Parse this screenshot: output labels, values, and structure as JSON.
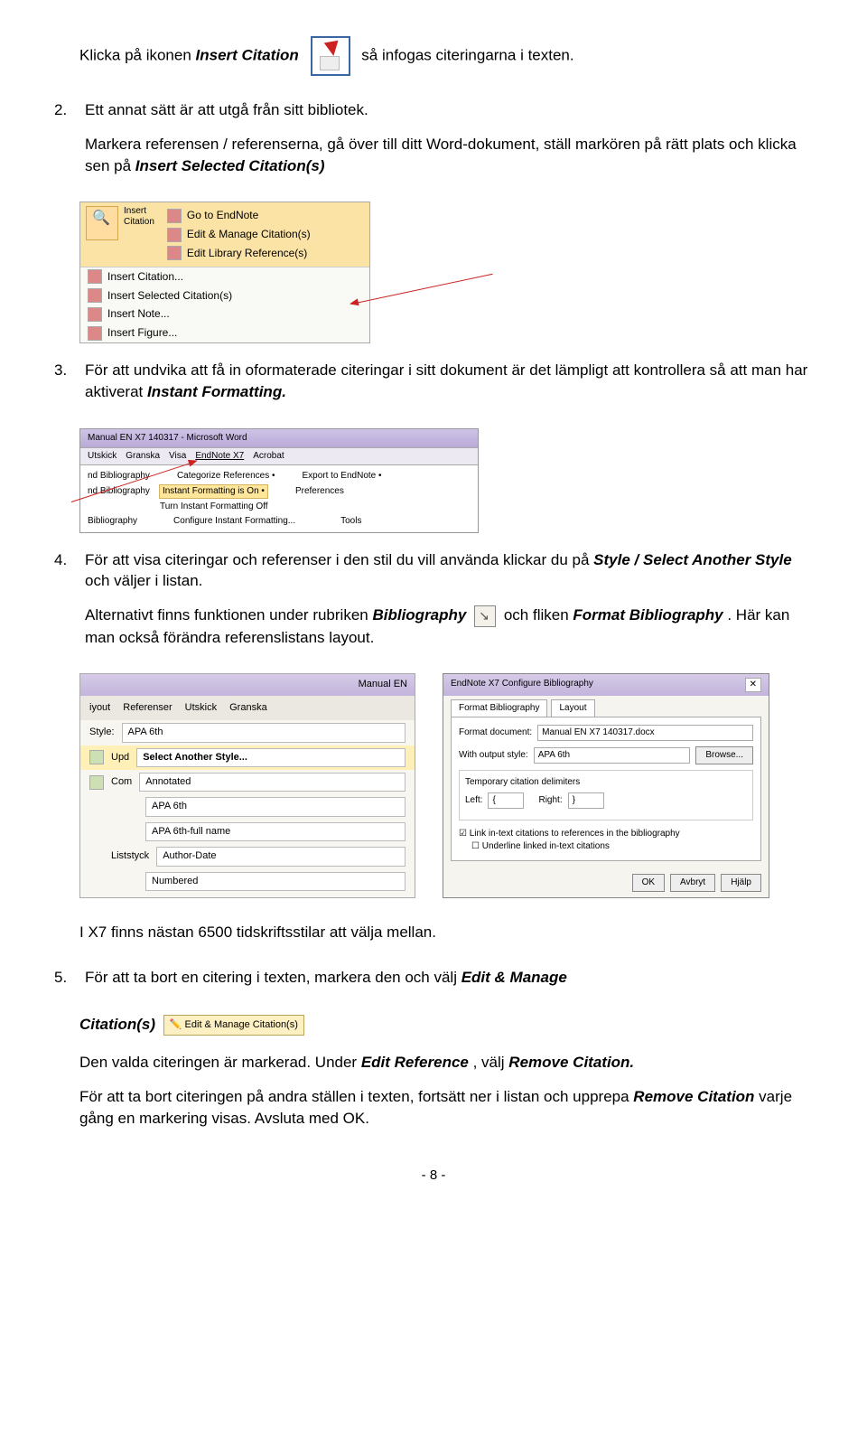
{
  "intro": {
    "pre": "Klicka på ikonen ",
    "em1": "Insert Citation",
    "post": "så infogas citeringarna i texten."
  },
  "item2": {
    "num": "2.",
    "line1": "Ett annat sätt är att utgå från sitt bibliotek.",
    "line2a": "Markera referensen / referenserna, gå över till ditt Word-dokument, ställ markören på rätt plats och klicka sen på ",
    "line2b": "Insert Selected Citation(s)"
  },
  "menu": {
    "insertLabel": "Insert",
    "citationLabel": "Citation",
    "items": [
      "Go to EndNote",
      "Edit & Manage Citation(s)",
      "Edit Library Reference(s)",
      "Insert Citation...",
      "Insert Selected Citation(s)",
      "Insert Note...",
      "Insert Figure..."
    ]
  },
  "item3": {
    "num": "3.",
    "texta": "För att undvika att få in oformaterade citeringar i sitt dokument är det lämpligt att kontrollera så att man har aktiverat ",
    "textb": "Instant Formatting."
  },
  "ribbon": {
    "title": "Manual EN X7 140317 - Microsoft Word",
    "tabs": [
      "Utskick",
      "Granska",
      "Visa",
      "EndNote X7",
      "Acrobat"
    ],
    "rows": {
      "r1a": "nd Bibliography",
      "r1b": "Categorize References •",
      "r1c": "Export to EndNote •",
      "r2": "Instant Formatting is On •",
      "r2b": "Preferences",
      "r3a": "Turn Instant Formatting Off",
      "r3b": "nd Bibliography",
      "r4": "Configure Instant Formatting...",
      "r5": "Bibliography",
      "r5b": "Tools"
    }
  },
  "item4": {
    "num": "4.",
    "a": "För att visa citeringar och referenser i den stil du vill använda klickar du på ",
    "b": "Style / Select Another Style",
    "c": " och väljer i listan.",
    "d": "Alternativt finns funktionen under rubriken ",
    "e": "Bibliography",
    "f": "och fliken ",
    "g": "Format Bibliography",
    "h": ". Här kan man också förändra referenslistans layout."
  },
  "styleShot": {
    "headerTitle": "Manual EN",
    "tabs": [
      "iyout",
      "Referenser",
      "Utskick",
      "Granska"
    ],
    "styleLabel": "Style:",
    "styleVal": "APA 6th",
    "upd": "Upd",
    "select": "Select Another Style...",
    "com": "Com",
    "opts": [
      "Annotated",
      "APA 6th",
      "APA 6th-full name",
      "Author-Date",
      "Numbered"
    ],
    "list": "Liststyck"
  },
  "cfgShot": {
    "title": "EndNote X7 Configure Bibliography",
    "tabs": [
      "Format Bibliography",
      "Layout"
    ],
    "fdoc": "Format document:",
    "fdocval": "Manual EN X7 140317.docx",
    "wout": "With output style:",
    "woutval": "APA 6th",
    "browse": "Browse...",
    "temp": "Temporary citation delimiters",
    "left": "Left:",
    "leftVal": "{",
    "right": "Right:",
    "rightVal": "}",
    "chk1": "Link in-text citations to references in the bibliography",
    "chk2": "Underline linked in-text citations",
    "ok": "OK",
    "cancel": "Avbryt",
    "help": "Hjälp"
  },
  "afterShots": "I X7 finns nästan 6500 tidskriftsstilar att välja mellan.",
  "item5": {
    "num": "5.",
    "a": "För att ta bort en citering i texten, markera den och välj ",
    "b": "Edit & Manage",
    "c": "Citation(s)",
    "btn": "Edit & Manage Citation(s)"
  },
  "tail": {
    "a": "Den valda citeringen är markerad. Under ",
    "b": "Edit Reference",
    "c": ", välj ",
    "d": "Remove Citation.",
    "e": "För att ta bort citeringen på andra ställen i texten, fortsätt ner i listan och upprepa ",
    "f": "Remove Citation",
    "g": " varje gång en markering visas. Avsluta med OK."
  },
  "page": "- 8 -"
}
